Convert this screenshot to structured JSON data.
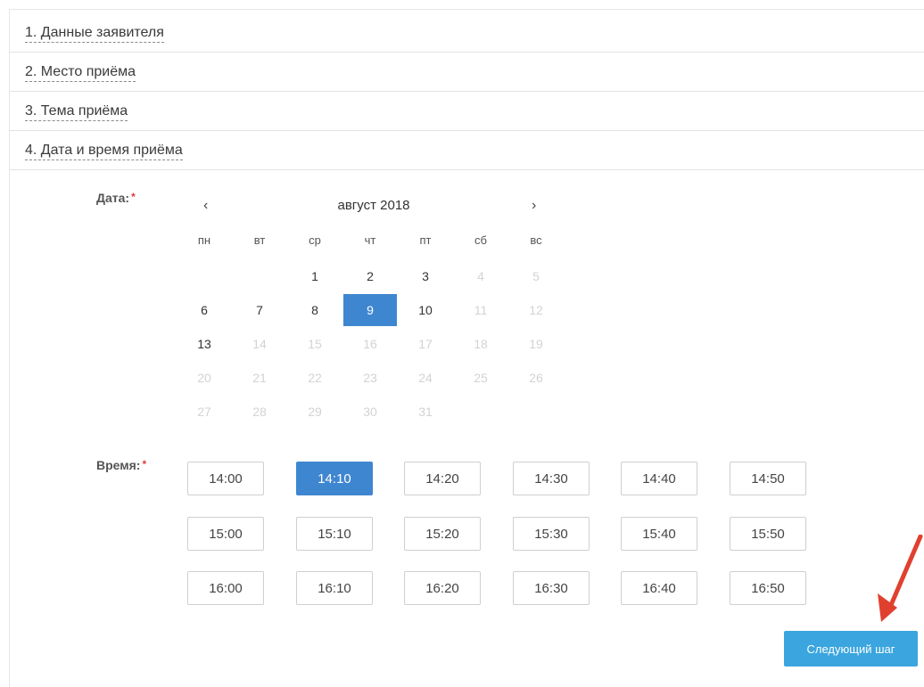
{
  "steps": [
    {
      "label": "1. Данные заявителя"
    },
    {
      "label": "2. Место приёма"
    },
    {
      "label": "3. Тема приёма"
    },
    {
      "label": "4. Дата и время приёма"
    }
  ],
  "date_label": "Дата:",
  "time_label": "Время:",
  "required_mark": "*",
  "calendar": {
    "prev": "‹",
    "next": "›",
    "month_title": "август 2018",
    "weekdays": [
      "пн",
      "вт",
      "ср",
      "чт",
      "пт",
      "сб",
      "вс"
    ],
    "weeks": [
      [
        null,
        null,
        {
          "d": "1",
          "s": "a"
        },
        {
          "d": "2",
          "s": "a"
        },
        {
          "d": "3",
          "s": "a"
        },
        {
          "d": "4",
          "s": "m"
        },
        {
          "d": "5",
          "s": "m"
        }
      ],
      [
        {
          "d": "6",
          "s": "a"
        },
        {
          "d": "7",
          "s": "a"
        },
        {
          "d": "8",
          "s": "a"
        },
        {
          "d": "9",
          "s": "sel"
        },
        {
          "d": "10",
          "s": "a"
        },
        {
          "d": "11",
          "s": "m"
        },
        {
          "d": "12",
          "s": "m"
        }
      ],
      [
        {
          "d": "13",
          "s": "a"
        },
        {
          "d": "14",
          "s": "m"
        },
        {
          "d": "15",
          "s": "m"
        },
        {
          "d": "16",
          "s": "m"
        },
        {
          "d": "17",
          "s": "m"
        },
        {
          "d": "18",
          "s": "m"
        },
        {
          "d": "19",
          "s": "m"
        }
      ],
      [
        {
          "d": "20",
          "s": "m"
        },
        {
          "d": "21",
          "s": "m"
        },
        {
          "d": "22",
          "s": "m"
        },
        {
          "d": "23",
          "s": "m"
        },
        {
          "d": "24",
          "s": "m"
        },
        {
          "d": "25",
          "s": "m"
        },
        {
          "d": "26",
          "s": "m"
        }
      ],
      [
        {
          "d": "27",
          "s": "m"
        },
        {
          "d": "28",
          "s": "m"
        },
        {
          "d": "29",
          "s": "m"
        },
        {
          "d": "30",
          "s": "m"
        },
        {
          "d": "31",
          "s": "m"
        },
        null,
        null
      ]
    ]
  },
  "time_slots": [
    [
      "14:00",
      "14:10",
      "14:20",
      "14:30",
      "14:40",
      "14:50"
    ],
    [
      "15:00",
      "15:10",
      "15:20",
      "15:30",
      "15:40",
      "15:50"
    ],
    [
      "16:00",
      "16:10",
      "16:20",
      "16:30",
      "16:40",
      "16:50"
    ]
  ],
  "selected_time": "14:10",
  "next_button": "Следующий шаг",
  "colors": {
    "selected": "#3f86d0",
    "button": "#3aa5de",
    "arrow": "#e0412f",
    "required": "#e23a3a"
  }
}
